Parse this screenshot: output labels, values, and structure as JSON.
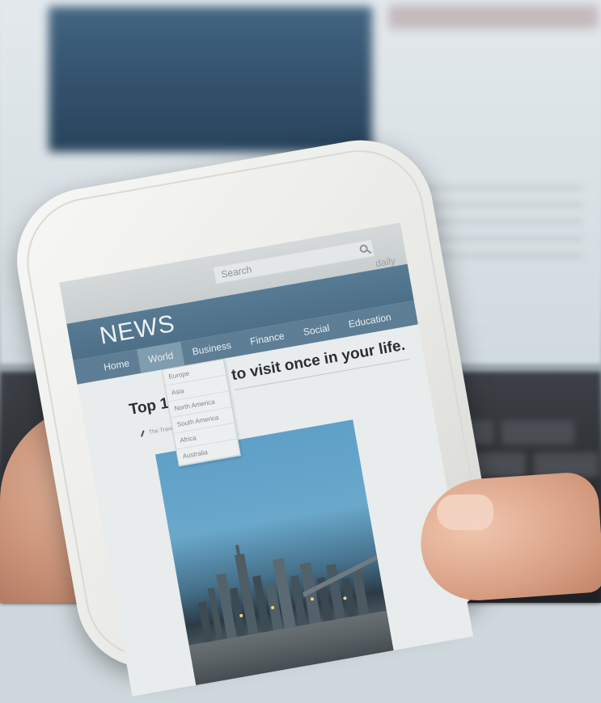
{
  "screen": {
    "search_placeholder": "Search",
    "daily_label": "daily",
    "masthead_title": "NEWS",
    "nav": {
      "items": [
        "Home",
        "World",
        "Business",
        "Finance",
        "Social",
        "Education"
      ],
      "active_index": 1
    },
    "dropdown": {
      "items": [
        "Europe",
        "Asia",
        "North America",
        "South America",
        "Africa",
        "Australia"
      ]
    },
    "headline": {
      "left_fragment": "Top 1",
      "right_fragment": "to visit once in your life."
    },
    "byline": "The Trave",
    "image": {
      "icon": "city-skyline-image"
    }
  },
  "colors": {
    "masthead": "#587b94",
    "nav": "#5d7e95",
    "nav_active": "#809caf"
  }
}
